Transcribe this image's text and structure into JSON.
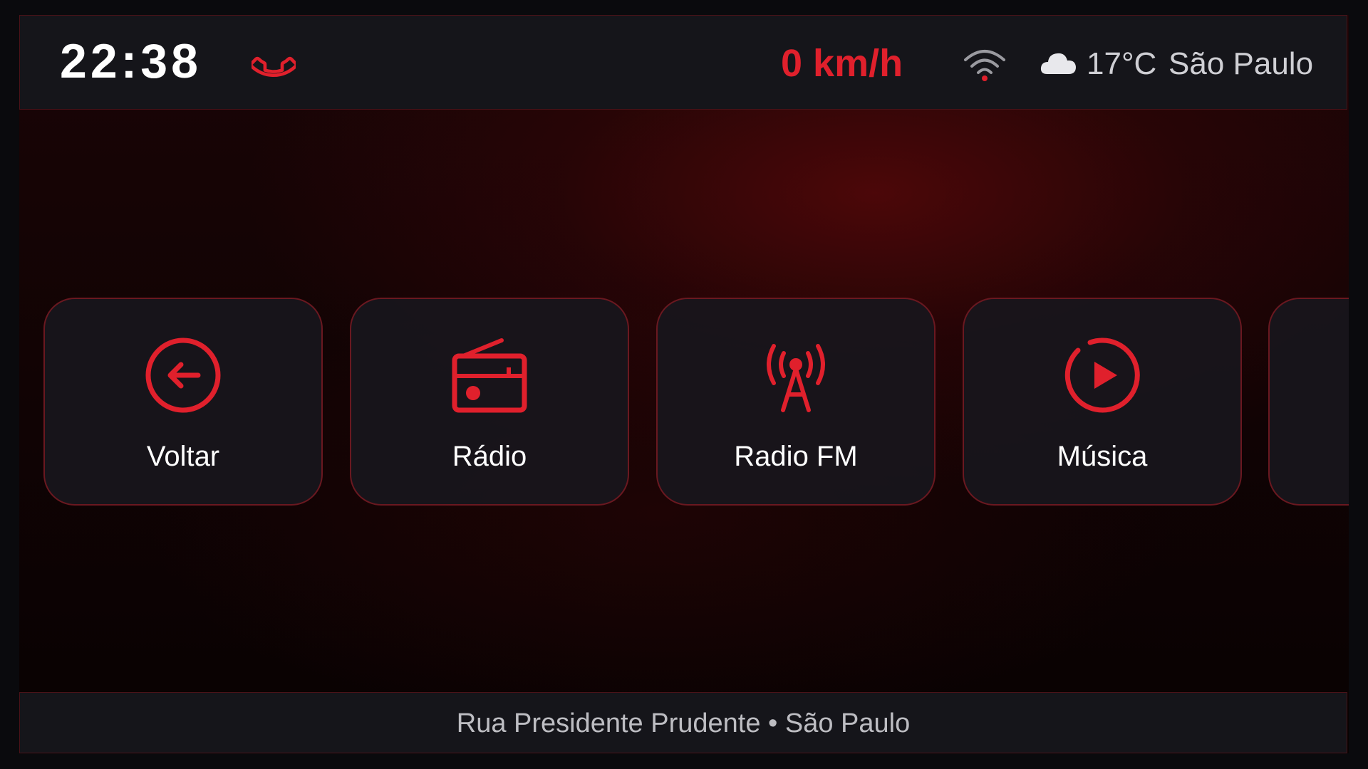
{
  "status_bar": {
    "time": "22:38",
    "speed": "0 km/h",
    "temperature": "17°C",
    "city": "São Paulo",
    "icons": [
      "phone-icon",
      "wifi-icon",
      "cloud-icon"
    ]
  },
  "apps": [
    {
      "label": "Voltar",
      "icon": "back-arrow-icon"
    },
    {
      "label": "Rádio",
      "icon": "radio-icon"
    },
    {
      "label": "Radio FM",
      "icon": "antenna-icon"
    },
    {
      "label": "Música",
      "icon": "play-icon"
    }
  ],
  "footer": {
    "location": "Rua Presidente Prudente • São Paulo"
  },
  "colors": {
    "accent": "#e0202c",
    "panel": "#15151a",
    "border": "#6a1820"
  }
}
